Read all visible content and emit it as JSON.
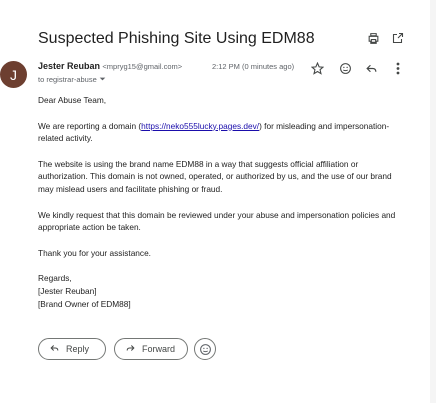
{
  "subject": "Suspected Phishing Site Using EDM88",
  "sender": {
    "avatar_letter": "J",
    "name": "Jester Reuban",
    "email": "<mpryg15@gmail.com>",
    "timestamp": "2:12 PM (0 minutes ago)"
  },
  "recipient": "to registrar-abuse",
  "body": {
    "greeting": "Dear Abuse Team,",
    "p1_before": "We are reporting a domain (",
    "p1_link": "https://neko555lucky.pages.dev/",
    "p1_after": ") for misleading and impersonation-related activity.",
    "p2": "The website is using the brand name EDM88 in a way that suggests official affiliation or authorization. This domain is not owned, operated, or authorized by us, and the use of our brand may mislead users and facilitate phishing or fraud.",
    "p3": "We kindly request that this domain be reviewed under your abuse and impersonation policies and appropriate action be taken.",
    "p4": "Thank you for your assistance.",
    "sig1": "Regards,",
    "sig2": "[Jester Reuban]",
    "sig3": "[Brand Owner of EDM88]"
  },
  "actions": {
    "reply_label": "Reply",
    "forward_label": "Forward"
  },
  "icons": {
    "print": "print-icon",
    "open_new": "open-in-new-icon",
    "star": "star-icon",
    "emoji": "emoji-icon",
    "reply": "reply-icon",
    "more": "more-vert-icon"
  }
}
